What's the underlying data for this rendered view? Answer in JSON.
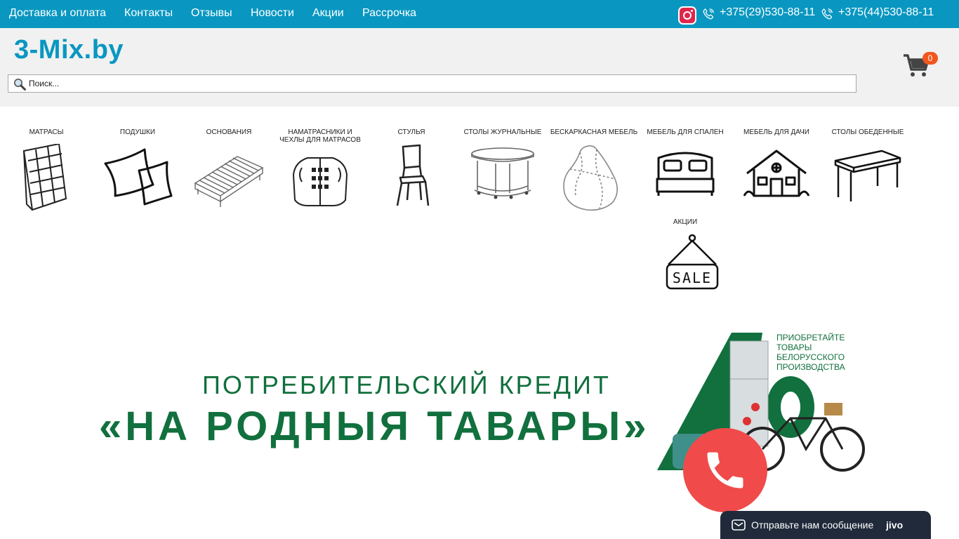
{
  "topnav": {
    "links": [
      "Доставка и оплата",
      "Контакты",
      "Отзывы",
      "Новости",
      "Акции",
      "Рассрочка"
    ],
    "phones": [
      "+375(29)530-88-11",
      "+375(44)530-88-11"
    ]
  },
  "header": {
    "logo": "3-Mix.by",
    "search_placeholder": "Поиск...",
    "cart_count": "0"
  },
  "categories": [
    "Матрасы",
    "Подушки",
    "Основания",
    "Наматрасники и чехлы для матрасов",
    "Стулья",
    "Столы журнальные",
    "Бескаркасная мебель",
    "Мебель для спален",
    "Мебель для дачи",
    "Столы обеденные",
    "Акции"
  ],
  "banner": {
    "line1": "ПОТРЕБИТЕЛЬСКИЙ КРЕДИТ",
    "line2": "«НА РОДНЫЯ ТАВАРЫ»",
    "side": "Приобретайте товары белорусского производства"
  },
  "chat": {
    "text": "Отправьте нам сообщение",
    "brand": "jivo"
  },
  "colors": {
    "accent": "#0997c1",
    "badge": "#f2561d",
    "call": "#f04a4a",
    "banner_green": "#11703d"
  }
}
